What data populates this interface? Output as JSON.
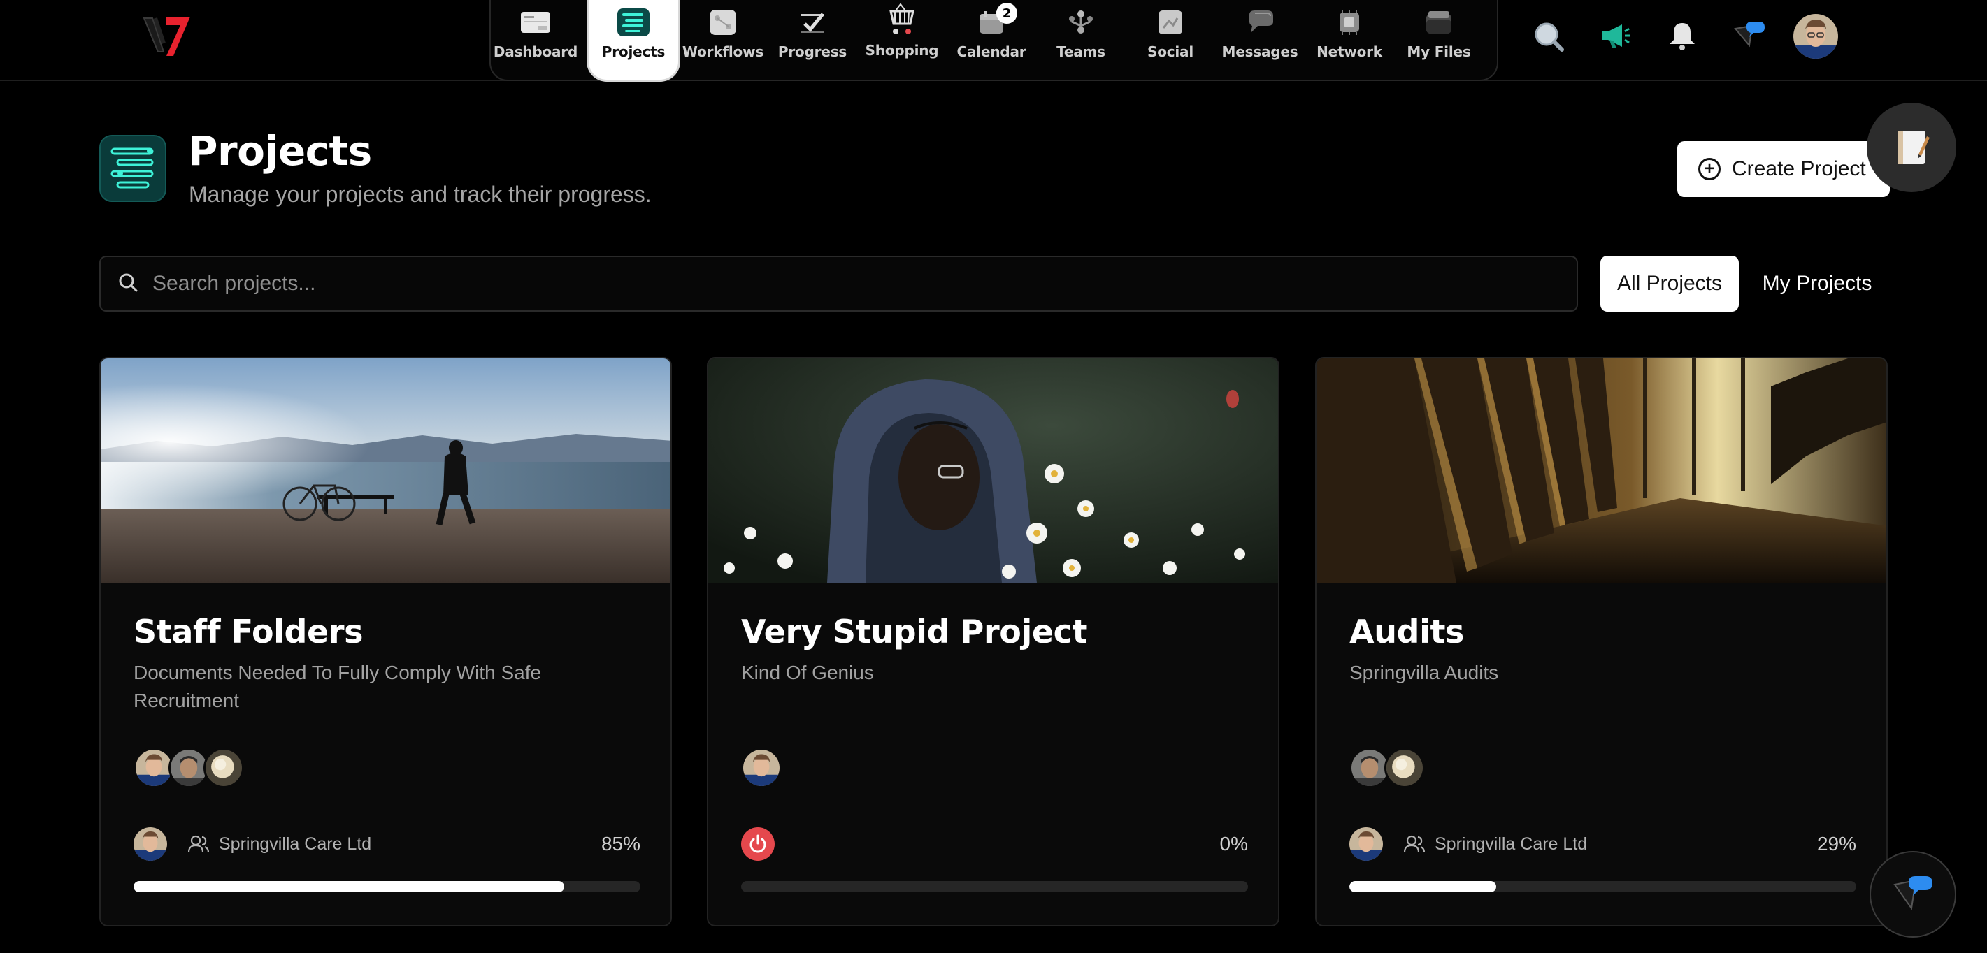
{
  "nav": {
    "items": [
      {
        "label": "Dashboard",
        "icon": "dashboard-icon"
      },
      {
        "label": "Projects",
        "icon": "projects-icon",
        "active": true
      },
      {
        "label": "Workflows",
        "icon": "workflows-icon"
      },
      {
        "label": "Progress",
        "icon": "progress-icon"
      },
      {
        "label": "Shopping",
        "icon": "shopping-icon"
      },
      {
        "label": "Calendar",
        "icon": "calendar-icon",
        "badge": "2"
      },
      {
        "label": "Teams",
        "icon": "teams-icon"
      },
      {
        "label": "Social",
        "icon": "social-icon"
      },
      {
        "label": "Messages",
        "icon": "messages-icon"
      },
      {
        "label": "Network",
        "icon": "network-icon"
      },
      {
        "label": "My Files",
        "icon": "my-files-icon"
      }
    ]
  },
  "header": {
    "title": "Projects",
    "subtitle": "Manage your projects and track their progress.",
    "create_label": "Create Project"
  },
  "search": {
    "placeholder": "Search projects..."
  },
  "filters": {
    "all": "All Projects",
    "mine": "My Projects"
  },
  "cards": [
    {
      "title": "Staff Folders",
      "description": "Documents Needed To Fully Comply With Safe Recruitment",
      "organization": "Springvilla Care Ltd",
      "progress_label": "85%",
      "progress": 0.85
    },
    {
      "title": "Very Stupid Project",
      "description": "Kind Of Genius",
      "organization": "",
      "progress_label": "0%",
      "progress": 0.0
    },
    {
      "title": "Audits",
      "description": "Springvilla Audits",
      "organization": "Springvilla Care Ltd",
      "progress_label": "29%",
      "progress": 0.29
    }
  ],
  "colors": {
    "accent_teal": "#0a3b3a",
    "power_red": "#e5484d",
    "chat_blue": "#2d8cf0"
  }
}
